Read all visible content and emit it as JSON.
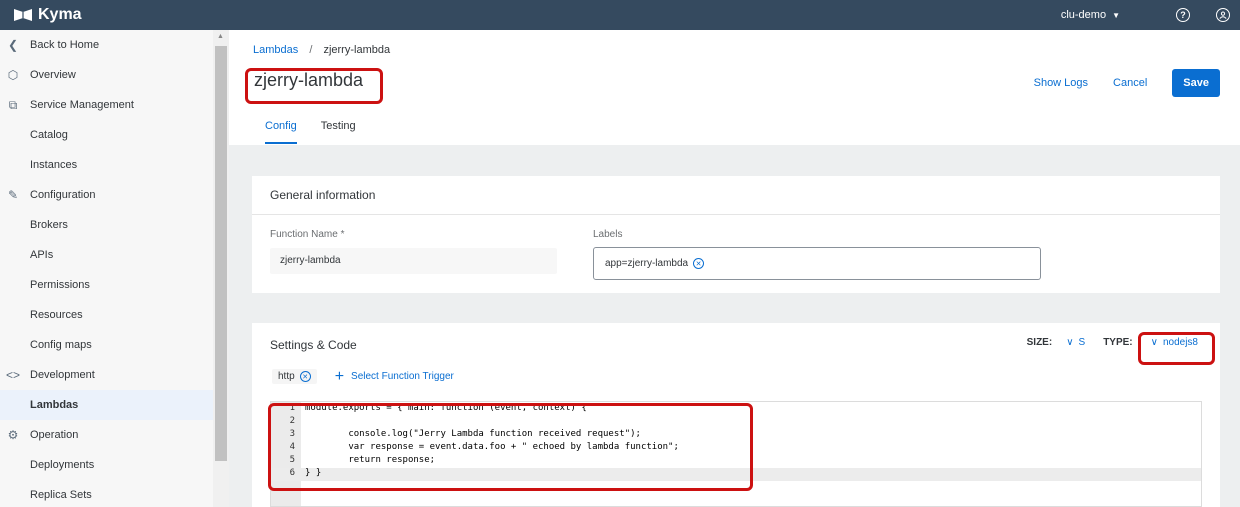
{
  "app": {
    "name": "Kyma",
    "cluster": "clu-demo"
  },
  "sidebar": {
    "items": [
      {
        "label": "Back to Home",
        "type": "group",
        "icon": "chevron-left-icon"
      },
      {
        "label": "Overview",
        "type": "group",
        "icon": "hexagon-icon"
      },
      {
        "label": "Service Management",
        "type": "group",
        "icon": "service-icon"
      },
      {
        "label": "Catalog",
        "type": "child"
      },
      {
        "label": "Instances",
        "type": "child"
      },
      {
        "label": "Configuration",
        "type": "group",
        "icon": "pencil-icon"
      },
      {
        "label": "Brokers",
        "type": "child"
      },
      {
        "label": "APIs",
        "type": "child"
      },
      {
        "label": "Permissions",
        "type": "child"
      },
      {
        "label": "Resources",
        "type": "child"
      },
      {
        "label": "Config maps",
        "type": "child"
      },
      {
        "label": "Development",
        "type": "group",
        "icon": "code-icon"
      },
      {
        "label": "Lambdas",
        "type": "child",
        "active": true
      },
      {
        "label": "Operation",
        "type": "group",
        "icon": "operation-icon"
      },
      {
        "label": "Deployments",
        "type": "child"
      },
      {
        "label": "Replica Sets",
        "type": "child"
      }
    ]
  },
  "header": {
    "breadcrumb": {
      "root": "Lambdas",
      "current": "zjerry-lambda"
    },
    "title": "zjerry-lambda",
    "tabs": [
      {
        "label": "Config",
        "active": true
      },
      {
        "label": "Testing"
      }
    ],
    "actions": {
      "show_logs": "Show Logs",
      "cancel": "Cancel",
      "save": "Save"
    }
  },
  "general": {
    "title": "General information",
    "function_name_label": "Function Name *",
    "function_name_value": "zjerry-lambda",
    "labels_label": "Labels",
    "label_token": "app=zjerry-lambda"
  },
  "settings": {
    "title": "Settings & Code",
    "size_key": "SIZE:",
    "size_value": "S",
    "type_key": "TYPE:",
    "type_value": "nodejs8",
    "trigger_chip": "http",
    "add_trigger": "Select Function Trigger"
  },
  "editor": {
    "lines": [
      {
        "n": "1",
        "code": "module.exports = { main: function (event, context) {"
      },
      {
        "n": "2",
        "code": ""
      },
      {
        "n": "3",
        "code": "        console.log(\"Jerry Lambda function received request\");"
      },
      {
        "n": "4",
        "code": "        var response = event.data.foo + \" echoed by lambda function\";"
      },
      {
        "n": "5",
        "code": "        return response;"
      },
      {
        "n": "6",
        "code": "} }"
      }
    ]
  },
  "colors": {
    "topbar": "#354a5f",
    "accent": "#0a6ed1",
    "highlight": "#cc1111"
  }
}
